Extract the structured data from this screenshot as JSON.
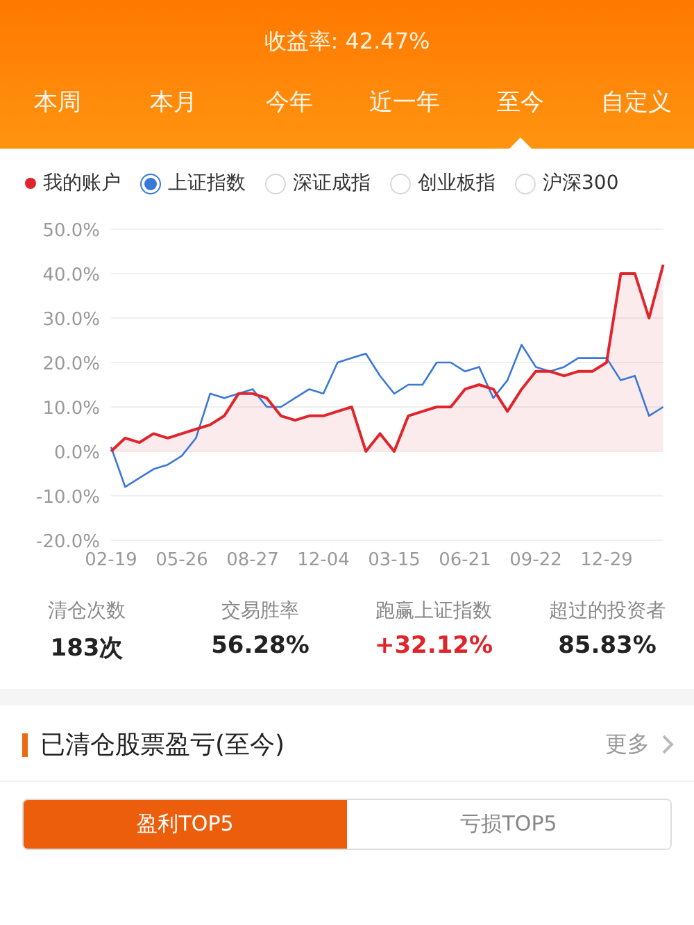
{
  "header": {
    "title": "收益率: 42.47%"
  },
  "period_tabs": [
    {
      "label": "本周",
      "selected": false
    },
    {
      "label": "本月",
      "selected": false
    },
    {
      "label": "今年",
      "selected": false
    },
    {
      "label": "近一年",
      "selected": false
    },
    {
      "label": "至今",
      "selected": true
    },
    {
      "label": "自定义",
      "selected": false
    }
  ],
  "legend": [
    {
      "kind": "dot",
      "color": "#e0242b"
    },
    {
      "kind": "radio",
      "selected": true
    },
    {
      "kind": "radio",
      "label": "深证成指",
      "selected": false
    },
    {
      "kind": "radio",
      "label": "创业板指",
      "selected": false
    },
    {
      "kind": "radio",
      "label": "沪深300",
      "selected": false
    }
  ],
  "chart_data": {
    "type": "line",
    "categories": [
      "02-19",
      null,
      null,
      null,
      null,
      "05-26",
      null,
      null,
      null,
      null,
      "08-27",
      null,
      null,
      null,
      null,
      "12-04",
      null,
      null,
      null,
      null,
      "03-15",
      null,
      null,
      null,
      null,
      "06-21",
      null,
      null,
      null,
      null,
      "09-22",
      null,
      null,
      null,
      null,
      "12-29",
      null,
      null,
      null,
      null
    ],
    "grid": true,
    "series": [
      {
        "name": "我的账户",
        "type": "area",
        "color": "#e0242b",
        "values": [
          0,
          3,
          2,
          4,
          3,
          4,
          5,
          6,
          8,
          13,
          13,
          12,
          8,
          7,
          8,
          8,
          9,
          10,
          0,
          4,
          0,
          8,
          9,
          10,
          10,
          14,
          15,
          14,
          9,
          14,
          18,
          18,
          17,
          18,
          18,
          20,
          40,
          40,
          30,
          42
        ]
      },
      {
        "name": "上证指数",
        "type": "line",
        "color": "#3a78d8",
        "values": [
          1,
          -8,
          -6,
          -4,
          -3,
          -1,
          3,
          13,
          12,
          13,
          14,
          10,
          10,
          12,
          14,
          13,
          20,
          21,
          22,
          17,
          13,
          15,
          15,
          20,
          20,
          18,
          19,
          12,
          16,
          24,
          19,
          18,
          19,
          21,
          21,
          21,
          16,
          17,
          8,
          10
        ]
      }
    ],
    "ylim": [
      -20,
      50
    ],
    "yticks": [
      {
        "value": 50,
        "label": "50.0%"
      },
      {
        "value": 40,
        "label": "40.0%"
      },
      {
        "value": 30,
        "label": "30.0%"
      },
      {
        "value": 20,
        "label": "20.0%"
      },
      {
        "value": 10,
        "label": "10.0%"
      },
      {
        "value": 0,
        "label": "0.0%"
      },
      {
        "value": -10,
        "label": "-10.0%"
      },
      {
        "value": -20,
        "label": "-20.0%"
      }
    ]
  },
  "stats": [
    {
      "label": "清仓次数",
      "value": "183次",
      "color": "#222222"
    },
    {
      "label": "交易胜率",
      "value": "56.28%",
      "color": "#222222"
    },
    {
      "label": "跑赢上证指数",
      "value": "+32.12%",
      "color": "#e0242b"
    },
    {
      "label": "超过的投资者",
      "value": "85.83%",
      "color": "#222222"
    }
  ],
  "section": {
    "title": "已清仓股票盈亏(至今)",
    "more": "更多"
  },
  "result_tabs": [
    {
      "label": "盈利TOP5",
      "selected": true
    },
    {
      "label": "亏损TOP5",
      "selected": false
    }
  ]
}
